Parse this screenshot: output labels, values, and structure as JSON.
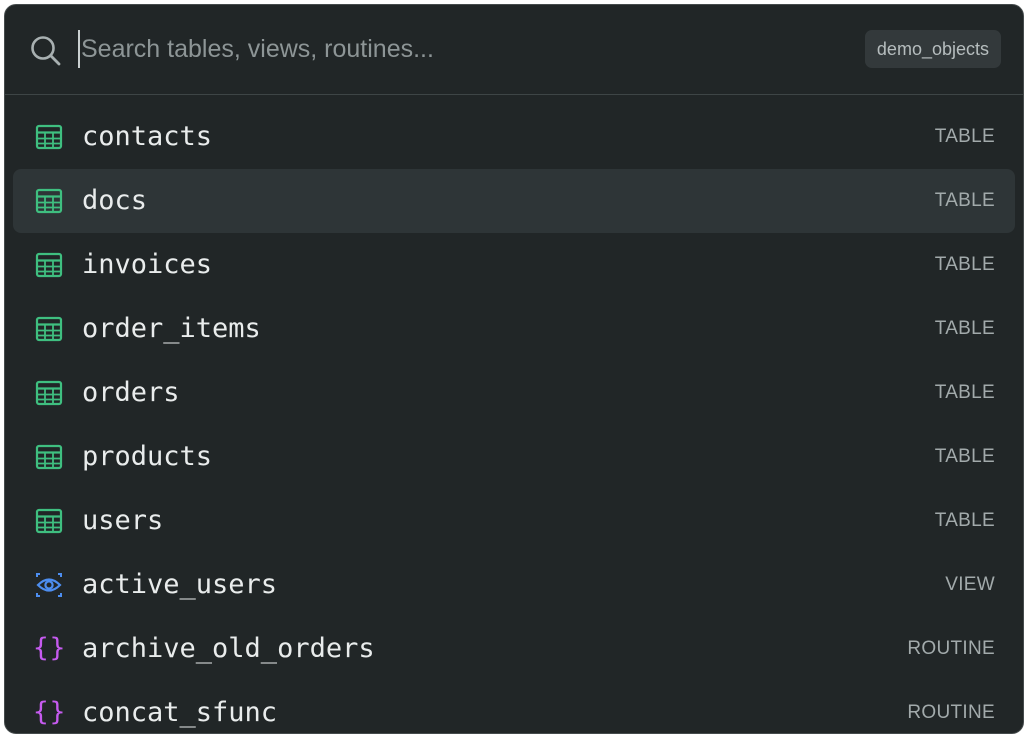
{
  "search": {
    "placeholder": "Search tables, views, routines...",
    "value": "",
    "schema_badge": "demo_objects"
  },
  "colors": {
    "table_icon": "#3fbf80",
    "view_icon": "#4d8ef0",
    "routine_icon": "#c65bf0",
    "selected_row_bg": "#2e3537",
    "background": "#212627"
  },
  "results": [
    {
      "name": "contacts",
      "kind": "TABLE",
      "icon": "table-icon",
      "selected": false
    },
    {
      "name": "docs",
      "kind": "TABLE",
      "icon": "table-icon",
      "selected": true
    },
    {
      "name": "invoices",
      "kind": "TABLE",
      "icon": "table-icon",
      "selected": false
    },
    {
      "name": "order_items",
      "kind": "TABLE",
      "icon": "table-icon",
      "selected": false
    },
    {
      "name": "orders",
      "kind": "TABLE",
      "icon": "table-icon",
      "selected": false
    },
    {
      "name": "products",
      "kind": "TABLE",
      "icon": "table-icon",
      "selected": false
    },
    {
      "name": "users",
      "kind": "TABLE",
      "icon": "table-icon",
      "selected": false
    },
    {
      "name": "active_users",
      "kind": "VIEW",
      "icon": "eye-icon",
      "selected": false
    },
    {
      "name": "archive_old_orders",
      "kind": "ROUTINE",
      "icon": "braces-icon",
      "selected": false
    },
    {
      "name": "concat_sfunc",
      "kind": "ROUTINE",
      "icon": "braces-icon",
      "selected": false
    }
  ]
}
